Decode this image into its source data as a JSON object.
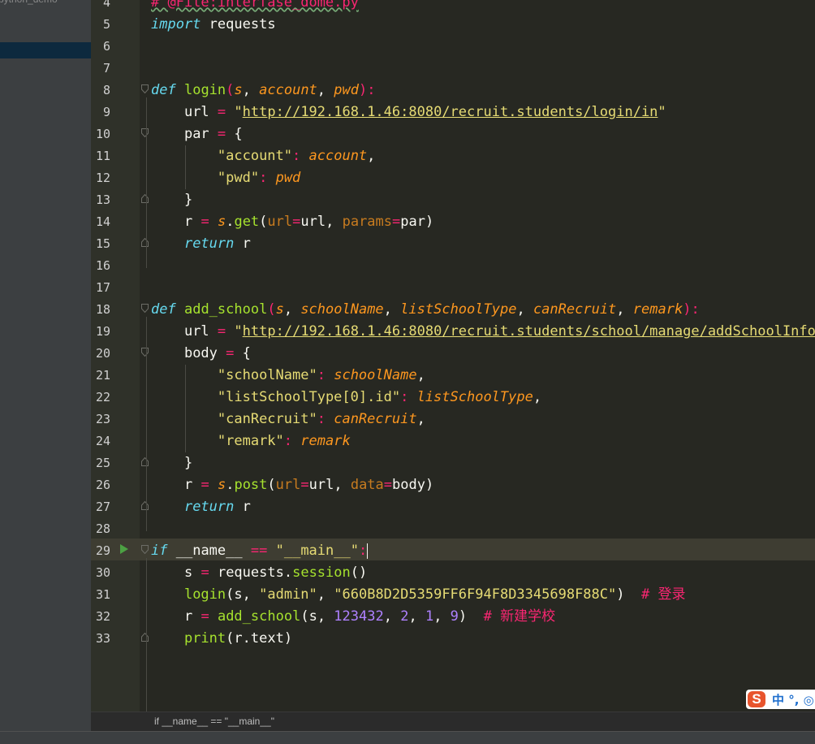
{
  "project": {
    "name": "python_demo"
  },
  "editor": {
    "line_numbers": [
      "4",
      "5",
      "6",
      "7",
      "8",
      "9",
      "10",
      "11",
      "12",
      "13",
      "14",
      "15",
      "16",
      "17",
      "18",
      "19",
      "20",
      "21",
      "22",
      "23",
      "24",
      "25",
      "26",
      "27",
      "28",
      "29",
      "30",
      "31",
      "32",
      "33"
    ],
    "current_line": "29",
    "header_comment": "# @File:interfase_dome.py",
    "kw": {
      "import": "import",
      "def": "def",
      "return": "return",
      "if": "if",
      "print": "print"
    },
    "login": {
      "name": "login",
      "p_s": "s",
      "p_account": "account",
      "p_pwd": "pwd",
      "url_var": "url",
      "url": "http://192.168.1.46:8080/recruit.students/login/in",
      "par_var": "par",
      "key_account": "\"account\"",
      "key_pwd": "\"pwd\"",
      "r_var": "r",
      "s_var": "s",
      "get": "get",
      "url_kw": "url",
      "params_kw": "params"
    },
    "add_school": {
      "name": "add_school",
      "p_s": "s",
      "p_schoolName": "schoolName",
      "p_listSchoolType": "listSchoolType",
      "p_canRecruit": "canRecruit",
      "p_remark": "remark",
      "url_var": "url",
      "url": "http://192.168.1.46:8080/recruit.students/school/manage/addSchoolInfo",
      "body_var": "body",
      "key_schoolName": "\"schoolName\"",
      "key_listSchoolType": "\"listSchoolType[0].id\"",
      "key_canRecruit": "\"canRecruit\"",
      "key_remark": "\"remark\"",
      "post": "post",
      "url_kw": "url",
      "data_kw": "data"
    },
    "main": {
      "name_var": "__name__",
      "main_str": "\"__main__\"",
      "requests": "requests",
      "session": "session",
      "arg_admin": "\"admin\"",
      "arg_pwd": "\"660B8D2D5359FF6F94F8D3345698F88C\"",
      "comment_login": "# 登录",
      "n1": "123432",
      "n2": "2",
      "n3": "1",
      "n4": "9",
      "comment_add": "# 新建学校",
      "text_attr": "text"
    }
  },
  "breadcrumb": "if __name__ == \"__main__\"",
  "ime": {
    "logo": "S",
    "text": "中 °, ◎"
  },
  "colors": {
    "background": "#272822",
    "keyword": "#66d9ef",
    "function": "#a6e22e",
    "param": "#fd971f",
    "string": "#e6db74",
    "number": "#ae81ff",
    "operator": "#f92672"
  }
}
